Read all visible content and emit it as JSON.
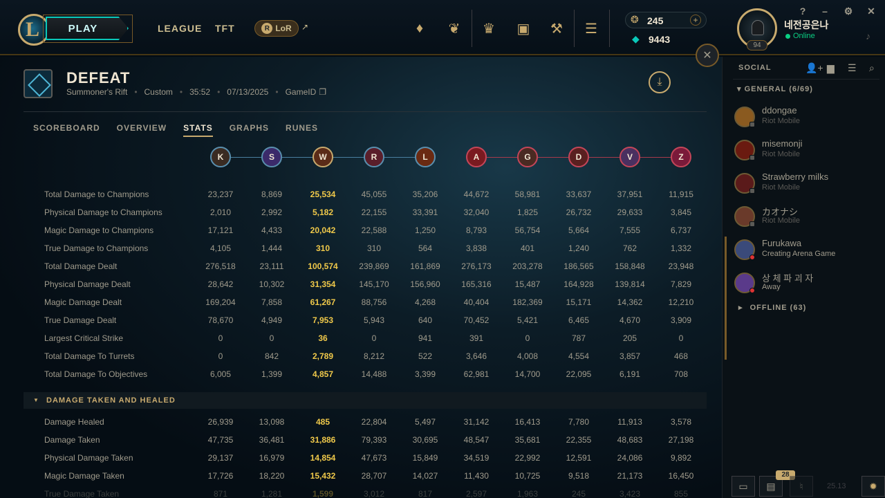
{
  "topbar": {
    "play_label": "PLAY",
    "nav": [
      "LEAGUE",
      "TFT"
    ],
    "lor_label": "LoR",
    "lor_arrow": "↗",
    "icons": [
      "champions-icon",
      "tft-icon",
      "rank-icon",
      "loot-icon",
      "collection-icon",
      "store-icon"
    ],
    "rp": "245",
    "blue_essence": "9443",
    "summoner_name": "네전공은나",
    "status": "Online",
    "level": "94",
    "window_controls": [
      "?",
      "–",
      "⚙",
      "✕"
    ]
  },
  "match": {
    "result": "DEFEAT",
    "map": "Summoner's Rift",
    "mode": "Custom",
    "duration": "35:52",
    "date": "07/13/2025",
    "game_id_label": "GameID"
  },
  "tabs": [
    "SCOREBOARD",
    "OVERVIEW",
    "STATS",
    "GRAPHS",
    "RUNES"
  ],
  "active_tab": "STATS",
  "players": [
    {
      "initial": "K",
      "team": "blue",
      "bg": "#3a2b22"
    },
    {
      "initial": "S",
      "team": "blue",
      "bg": "#3b2a6a"
    },
    {
      "initial": "W",
      "team": "blue",
      "bg": "#5a2b18",
      "me": true
    },
    {
      "initial": "R",
      "team": "blue",
      "bg": "#5a1e2a"
    },
    {
      "initial": "L",
      "team": "blue",
      "bg": "#6a2a12"
    },
    {
      "initial": "A",
      "team": "red",
      "bg": "#7a1a20"
    },
    {
      "initial": "G",
      "team": "red",
      "bg": "#4a2a22"
    },
    {
      "initial": "D",
      "team": "red",
      "bg": "#5a2020"
    },
    {
      "initial": "V",
      "team": "red",
      "bg": "#4a3060"
    },
    {
      "initial": "Z",
      "team": "red",
      "bg": "#7a1a3a"
    }
  ],
  "stats": [
    {
      "label": "Total Damage to Champions",
      "values": [
        "23,237",
        "8,869",
        "25,534",
        "45,055",
        "35,206",
        "44,672",
        "58,981",
        "33,637",
        "37,951",
        "11,915"
      ]
    },
    {
      "label": "Physical Damage to Champions",
      "values": [
        "2,010",
        "2,992",
        "5,182",
        "22,155",
        "33,391",
        "32,040",
        "1,825",
        "26,732",
        "29,633",
        "3,845"
      ]
    },
    {
      "label": "Magic Damage to Champions",
      "values": [
        "17,121",
        "4,433",
        "20,042",
        "22,588",
        "1,250",
        "8,793",
        "56,754",
        "5,664",
        "7,555",
        "6,737"
      ]
    },
    {
      "label": "True Damage to Champions",
      "values": [
        "4,105",
        "1,444",
        "310",
        "310",
        "564",
        "3,838",
        "401",
        "1,240",
        "762",
        "1,332"
      ]
    },
    {
      "label": "Total Damage Dealt",
      "values": [
        "276,518",
        "23,111",
        "100,574",
        "239,869",
        "161,869",
        "276,173",
        "203,278",
        "186,565",
        "158,848",
        "23,948"
      ]
    },
    {
      "label": "Physical Damage Dealt",
      "values": [
        "28,642",
        "10,302",
        "31,354",
        "145,170",
        "156,960",
        "165,316",
        "15,487",
        "164,928",
        "139,814",
        "7,829"
      ]
    },
    {
      "label": "Magic Damage Dealt",
      "values": [
        "169,204",
        "7,858",
        "61,267",
        "88,756",
        "4,268",
        "40,404",
        "182,369",
        "15,171",
        "14,362",
        "12,210"
      ]
    },
    {
      "label": "True Damage Dealt",
      "values": [
        "78,670",
        "4,949",
        "7,953",
        "5,943",
        "640",
        "70,452",
        "5,421",
        "6,465",
        "4,670",
        "3,909"
      ]
    },
    {
      "label": "Largest Critical Strike",
      "values": [
        "0",
        "0",
        "36",
        "0",
        "941",
        "391",
        "0",
        "787",
        "205",
        "0"
      ]
    },
    {
      "label": "Total Damage To Turrets",
      "values": [
        "0",
        "842",
        "2,789",
        "8,212",
        "522",
        "3,646",
        "4,008",
        "4,554",
        "3,857",
        "468"
      ]
    },
    {
      "label": "Total Damage To Objectives",
      "values": [
        "6,005",
        "1,399",
        "4,857",
        "14,488",
        "3,399",
        "62,981",
        "14,700",
        "22,095",
        "6,191",
        "708"
      ]
    }
  ],
  "section2_title": "DAMAGE TAKEN AND HEALED",
  "stats2": [
    {
      "label": "Damage Healed",
      "values": [
        "26,939",
        "13,098",
        "485",
        "22,804",
        "5,497",
        "31,142",
        "16,413",
        "7,780",
        "11,913",
        "3,578"
      ]
    },
    {
      "label": "Damage Taken",
      "values": [
        "47,735",
        "36,481",
        "31,886",
        "79,393",
        "30,695",
        "48,547",
        "35,681",
        "22,355",
        "48,683",
        "27,198"
      ]
    },
    {
      "label": "Physical Damage Taken",
      "values": [
        "29,137",
        "16,979",
        "14,854",
        "47,673",
        "15,849",
        "34,519",
        "22,992",
        "12,591",
        "24,086",
        "9,892"
      ]
    },
    {
      "label": "Magic Damage Taken",
      "values": [
        "17,726",
        "18,220",
        "15,432",
        "28,707",
        "14,027",
        "11,430",
        "10,725",
        "9,518",
        "21,173",
        "16,450"
      ]
    },
    {
      "label": "True Damage Taken",
      "values": [
        "871",
        "1,281",
        "1,599",
        "3,012",
        "817",
        "2,597",
        "1,963",
        "245",
        "3,423",
        "855"
      ],
      "faded": true
    }
  ],
  "social": {
    "title": "SOCIAL",
    "general_label": "GENERAL (6/69)",
    "offline_label": "OFFLINE (63)",
    "friends": [
      {
        "name": "ddongae",
        "sub": "Riot Mobile",
        "status": "mobile",
        "bg": "#8a5a20"
      },
      {
        "name": "misemonji",
        "sub": "Riot Mobile",
        "status": "mobile",
        "bg": "#6a1a10"
      },
      {
        "name": "Strawberry milks",
        "sub": "Riot Mobile",
        "status": "mobile",
        "bg": "#5a1a1a"
      },
      {
        "name": "カオナシ",
        "sub": "Riot Mobile",
        "status": "mobile",
        "bg": "#6a3a2a"
      },
      {
        "name": "Furukawa",
        "sub": "Creating Arena Game",
        "status": "ingame",
        "bg": "#3a4a7a"
      },
      {
        "name": "상 체 파 괴 자",
        "sub": "Away",
        "status": "ingame",
        "bg": "#5a3a8a"
      }
    ],
    "notification_count": "28",
    "version": "25.13"
  },
  "colors": {
    "gold": "#c8aa6e",
    "blue_team": "#5a8fae",
    "red_team": "#c44659",
    "highlight": "#f0c94a"
  }
}
